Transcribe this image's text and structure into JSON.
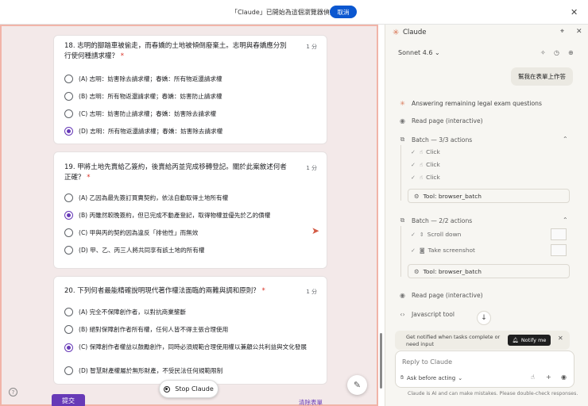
{
  "banner": {
    "message": "「Claude」已開始為這個瀏覽器偵錯",
    "cancel_label": "取消"
  },
  "form": {
    "questions": [
      {
        "title": "18. 志明的腳踏車被偷走，而春嬌的土地被傾倒廢棄土。志明與春嬌應分別行使何種請求權？",
        "required_mark": "*",
        "points": "1 分",
        "options": [
          "(A) 志明：妨害除去請求權；春嬌：所有物返還請求權",
          "(B) 志明：所有物返還請求權；春嬌：妨害防止請求權",
          "(C) 志明：妨害防止請求權；春嬌：妨害除去請求權",
          "(D) 志明：所有物返還請求權；春嬌：妨害除去請求權"
        ],
        "selected": 3
      },
      {
        "title": "19. 甲將土地先賣給乙簽約，後賣給丙並完成移轉登記。關於此案敘述何者正確？",
        "required_mark": "*",
        "points": "1 分",
        "options": [
          "(A) 乙因為最先簽訂買賣契約，依法自動取得土地所有權",
          "(B) 丙雖然較晚簽約，但已完成不動產登記，取得物權並優先於乙的債權",
          "(C) 甲與丙的契約因為違反「排他性」而無效",
          "(D) 甲、乙、丙三人將共同享有該土地的所有權"
        ],
        "selected": 1
      },
      {
        "title": "20. 下列何者最能精確說明現代著作權法面臨的兩難與調和原則？",
        "required_mark": "*",
        "points": "1 分",
        "options": [
          "(A) 完全不保障創作者，以對抗商業壟斷",
          "(B) 絕對保障創作者所有權，任何人皆不得主張合理使用",
          "(C) 保障創作者權益以鼓勵創作，同時必須規範合理使用權以兼顧公共利益與文化發展",
          "(D) 智慧財產權屬於無形財產，不受民法任何規範限制"
        ],
        "selected": 2
      }
    ],
    "submit_label": "提交",
    "clear_label": "清除表單",
    "stop_label": "Stop Claude",
    "help_glyph": "?"
  },
  "side": {
    "title": "Claude",
    "model": "Sonnet 4.6",
    "user_message": "幫我在表單上作答",
    "status_task": "Answering remaining legal exam questions",
    "read_page_1": "Read page (interactive)",
    "batch1": {
      "title": "Batch — 3/3 actions",
      "actions": [
        "Click",
        "Click",
        "Click"
      ],
      "tool": "Tool: browser_batch"
    },
    "batch2": {
      "title": "Batch — 2/2 actions",
      "actions": [
        "Scroll down",
        "Take screenshot"
      ],
      "tool": "Tool: browser_batch"
    },
    "read_page_2": "Read page (interactive)",
    "js_tool": "Javascript tool",
    "notify_text": "Get notified when tasks complete or need input",
    "notify_button": "Notify me",
    "composer_placeholder": "Reply to Claude",
    "ask_mode": "Ask before acting",
    "disclaimer": "Claude is AI and can make mistakes. Please double-check responses."
  },
  "colors": {
    "accent_purple": "#673ab7",
    "claude_orange": "#d97757",
    "banner_blue": "#0b57d0"
  }
}
